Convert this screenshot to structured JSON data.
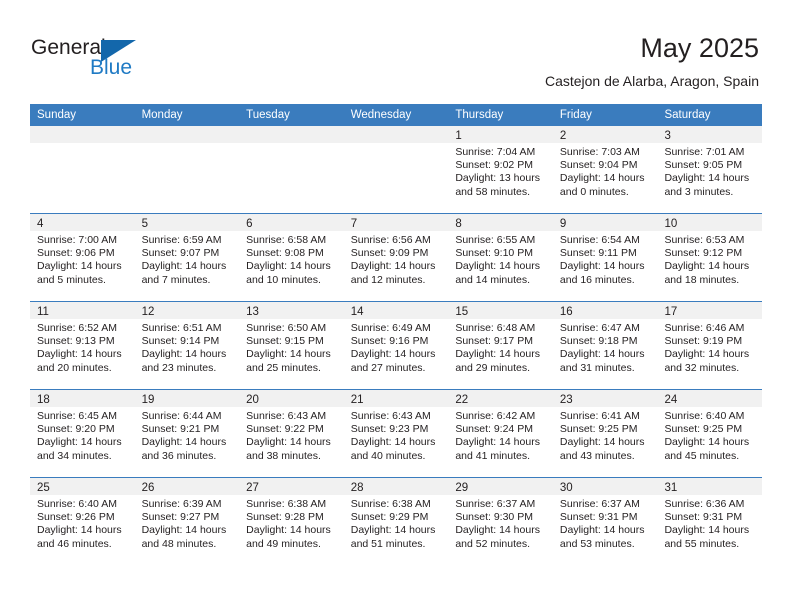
{
  "brand": {
    "line1": "General",
    "line2": "Blue",
    "triangle_color": "#1367ab",
    "blue_text_color": "#1f7ac4"
  },
  "header": {
    "title": "May 2025",
    "subtitle": "Castejon de Alarba, Aragon, Spain"
  },
  "theme": {
    "header_bar_color": "#3a7cbe",
    "daynum_band_color": "#f1f1f1",
    "text_color": "#231f20"
  },
  "weekdays": [
    "Sunday",
    "Monday",
    "Tuesday",
    "Wednesday",
    "Thursday",
    "Friday",
    "Saturday"
  ],
  "labels": {
    "sunrise_prefix": "Sunrise: ",
    "sunset_prefix": "Sunset: ",
    "daylight_prefix": "Daylight: "
  },
  "weeks": [
    [
      {
        "day": "",
        "sunrise": "",
        "sunset": "",
        "daylight_l1": "",
        "daylight_l2": ""
      },
      {
        "day": "",
        "sunrise": "",
        "sunset": "",
        "daylight_l1": "",
        "daylight_l2": ""
      },
      {
        "day": "",
        "sunrise": "",
        "sunset": "",
        "daylight_l1": "",
        "daylight_l2": ""
      },
      {
        "day": "",
        "sunrise": "",
        "sunset": "",
        "daylight_l1": "",
        "daylight_l2": ""
      },
      {
        "day": "1",
        "sunrise": "Sunrise: 7:04 AM",
        "sunset": "Sunset: 9:02 PM",
        "daylight_l1": "Daylight: 13 hours",
        "daylight_l2": "and 58 minutes."
      },
      {
        "day": "2",
        "sunrise": "Sunrise: 7:03 AM",
        "sunset": "Sunset: 9:04 PM",
        "daylight_l1": "Daylight: 14 hours",
        "daylight_l2": "and 0 minutes."
      },
      {
        "day": "3",
        "sunrise": "Sunrise: 7:01 AM",
        "sunset": "Sunset: 9:05 PM",
        "daylight_l1": "Daylight: 14 hours",
        "daylight_l2": "and 3 minutes."
      }
    ],
    [
      {
        "day": "4",
        "sunrise": "Sunrise: 7:00 AM",
        "sunset": "Sunset: 9:06 PM",
        "daylight_l1": "Daylight: 14 hours",
        "daylight_l2": "and 5 minutes."
      },
      {
        "day": "5",
        "sunrise": "Sunrise: 6:59 AM",
        "sunset": "Sunset: 9:07 PM",
        "daylight_l1": "Daylight: 14 hours",
        "daylight_l2": "and 7 minutes."
      },
      {
        "day": "6",
        "sunrise": "Sunrise: 6:58 AM",
        "sunset": "Sunset: 9:08 PM",
        "daylight_l1": "Daylight: 14 hours",
        "daylight_l2": "and 10 minutes."
      },
      {
        "day": "7",
        "sunrise": "Sunrise: 6:56 AM",
        "sunset": "Sunset: 9:09 PM",
        "daylight_l1": "Daylight: 14 hours",
        "daylight_l2": "and 12 minutes."
      },
      {
        "day": "8",
        "sunrise": "Sunrise: 6:55 AM",
        "sunset": "Sunset: 9:10 PM",
        "daylight_l1": "Daylight: 14 hours",
        "daylight_l2": "and 14 minutes."
      },
      {
        "day": "9",
        "sunrise": "Sunrise: 6:54 AM",
        "sunset": "Sunset: 9:11 PM",
        "daylight_l1": "Daylight: 14 hours",
        "daylight_l2": "and 16 minutes."
      },
      {
        "day": "10",
        "sunrise": "Sunrise: 6:53 AM",
        "sunset": "Sunset: 9:12 PM",
        "daylight_l1": "Daylight: 14 hours",
        "daylight_l2": "and 18 minutes."
      }
    ],
    [
      {
        "day": "11",
        "sunrise": "Sunrise: 6:52 AM",
        "sunset": "Sunset: 9:13 PM",
        "daylight_l1": "Daylight: 14 hours",
        "daylight_l2": "and 20 minutes."
      },
      {
        "day": "12",
        "sunrise": "Sunrise: 6:51 AM",
        "sunset": "Sunset: 9:14 PM",
        "daylight_l1": "Daylight: 14 hours",
        "daylight_l2": "and 23 minutes."
      },
      {
        "day": "13",
        "sunrise": "Sunrise: 6:50 AM",
        "sunset": "Sunset: 9:15 PM",
        "daylight_l1": "Daylight: 14 hours",
        "daylight_l2": "and 25 minutes."
      },
      {
        "day": "14",
        "sunrise": "Sunrise: 6:49 AM",
        "sunset": "Sunset: 9:16 PM",
        "daylight_l1": "Daylight: 14 hours",
        "daylight_l2": "and 27 minutes."
      },
      {
        "day": "15",
        "sunrise": "Sunrise: 6:48 AM",
        "sunset": "Sunset: 9:17 PM",
        "daylight_l1": "Daylight: 14 hours",
        "daylight_l2": "and 29 minutes."
      },
      {
        "day": "16",
        "sunrise": "Sunrise: 6:47 AM",
        "sunset": "Sunset: 9:18 PM",
        "daylight_l1": "Daylight: 14 hours",
        "daylight_l2": "and 31 minutes."
      },
      {
        "day": "17",
        "sunrise": "Sunrise: 6:46 AM",
        "sunset": "Sunset: 9:19 PM",
        "daylight_l1": "Daylight: 14 hours",
        "daylight_l2": "and 32 minutes."
      }
    ],
    [
      {
        "day": "18",
        "sunrise": "Sunrise: 6:45 AM",
        "sunset": "Sunset: 9:20 PM",
        "daylight_l1": "Daylight: 14 hours",
        "daylight_l2": "and 34 minutes."
      },
      {
        "day": "19",
        "sunrise": "Sunrise: 6:44 AM",
        "sunset": "Sunset: 9:21 PM",
        "daylight_l1": "Daylight: 14 hours",
        "daylight_l2": "and 36 minutes."
      },
      {
        "day": "20",
        "sunrise": "Sunrise: 6:43 AM",
        "sunset": "Sunset: 9:22 PM",
        "daylight_l1": "Daylight: 14 hours",
        "daylight_l2": "and 38 minutes."
      },
      {
        "day": "21",
        "sunrise": "Sunrise: 6:43 AM",
        "sunset": "Sunset: 9:23 PM",
        "daylight_l1": "Daylight: 14 hours",
        "daylight_l2": "and 40 minutes."
      },
      {
        "day": "22",
        "sunrise": "Sunrise: 6:42 AM",
        "sunset": "Sunset: 9:24 PM",
        "daylight_l1": "Daylight: 14 hours",
        "daylight_l2": "and 41 minutes."
      },
      {
        "day": "23",
        "sunrise": "Sunrise: 6:41 AM",
        "sunset": "Sunset: 9:25 PM",
        "daylight_l1": "Daylight: 14 hours",
        "daylight_l2": "and 43 minutes."
      },
      {
        "day": "24",
        "sunrise": "Sunrise: 6:40 AM",
        "sunset": "Sunset: 9:25 PM",
        "daylight_l1": "Daylight: 14 hours",
        "daylight_l2": "and 45 minutes."
      }
    ],
    [
      {
        "day": "25",
        "sunrise": "Sunrise: 6:40 AM",
        "sunset": "Sunset: 9:26 PM",
        "daylight_l1": "Daylight: 14 hours",
        "daylight_l2": "and 46 minutes."
      },
      {
        "day": "26",
        "sunrise": "Sunrise: 6:39 AM",
        "sunset": "Sunset: 9:27 PM",
        "daylight_l1": "Daylight: 14 hours",
        "daylight_l2": "and 48 minutes."
      },
      {
        "day": "27",
        "sunrise": "Sunrise: 6:38 AM",
        "sunset": "Sunset: 9:28 PM",
        "daylight_l1": "Daylight: 14 hours",
        "daylight_l2": "and 49 minutes."
      },
      {
        "day": "28",
        "sunrise": "Sunrise: 6:38 AM",
        "sunset": "Sunset: 9:29 PM",
        "daylight_l1": "Daylight: 14 hours",
        "daylight_l2": "and 51 minutes."
      },
      {
        "day": "29",
        "sunrise": "Sunrise: 6:37 AM",
        "sunset": "Sunset: 9:30 PM",
        "daylight_l1": "Daylight: 14 hours",
        "daylight_l2": "and 52 minutes."
      },
      {
        "day": "30",
        "sunrise": "Sunrise: 6:37 AM",
        "sunset": "Sunset: 9:31 PM",
        "daylight_l1": "Daylight: 14 hours",
        "daylight_l2": "and 53 minutes."
      },
      {
        "day": "31",
        "sunrise": "Sunrise: 6:36 AM",
        "sunset": "Sunset: 9:31 PM",
        "daylight_l1": "Daylight: 14 hours",
        "daylight_l2": "and 55 minutes."
      }
    ]
  ]
}
